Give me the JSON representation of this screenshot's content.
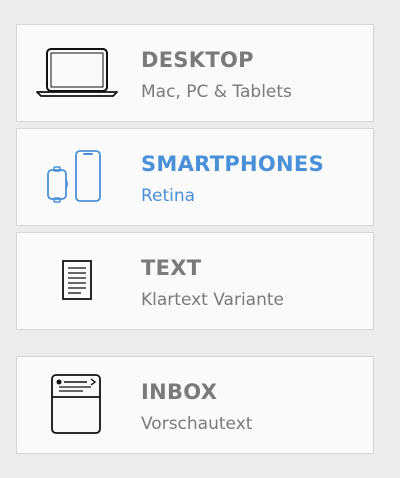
{
  "options": [
    {
      "title": "DESKTOP",
      "subtitle": "Mac, PC & Tablets",
      "icon": "laptop-icon",
      "selected": false
    },
    {
      "title": "SMARTPHONES",
      "subtitle": "Retina",
      "icon": "phone-watch-icon",
      "selected": true
    },
    {
      "title": "TEXT",
      "subtitle": "Klartext Variante",
      "icon": "document-icon",
      "selected": false
    },
    {
      "title": "INBOX",
      "subtitle": "Vorschautext",
      "icon": "inbox-icon",
      "selected": false
    }
  ],
  "colors": {
    "accent": "#4a90d9",
    "text": "#7a7a7a",
    "card_background": "#fafafa",
    "page_background": "#ececec"
  }
}
